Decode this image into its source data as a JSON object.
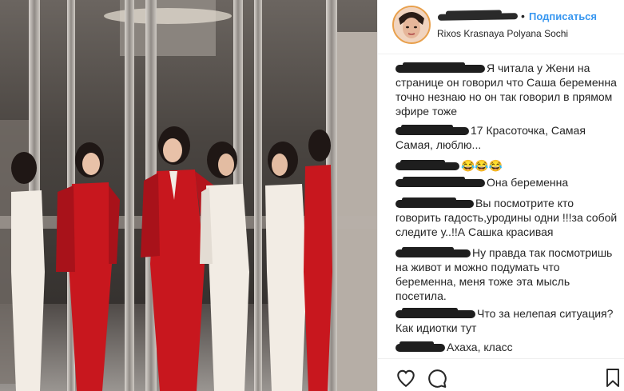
{
  "header": {
    "follow_label": "Подписаться",
    "location": "Rixos Krasnaya Polyana Sochi",
    "separator": "•"
  },
  "comments": [
    {
      "text": "Я читала у Жени на странице он говорил что Саша беременна точно незнаю но он так говорил в прямом эфире тоже"
    },
    {
      "text": "17 Красоточка, Самая Самая, люблю..."
    },
    {
      "text": "😂😂😂"
    },
    {
      "text": "Она беременна"
    },
    {
      "text": "Вы посмотрите кто говорить гадость,уродины одни !!!за собой следите у..!!А Сашка красивая"
    },
    {
      "text": "Ну правда так посмотришь на живот и можно подумать что беременна, меня тоже эта мысль посетила."
    },
    {
      "text": "Что за нелепая ситуация? Как идиотки тут"
    },
    {
      "text": "Ахаха, класс"
    }
  ],
  "icons": {
    "like": "heart-icon",
    "comment": "speech-bubble-icon",
    "save": "bookmark-icon"
  },
  "colors": {
    "accent": "#3897f0",
    "text": "#262626",
    "suit_red": "#c8171e"
  }
}
